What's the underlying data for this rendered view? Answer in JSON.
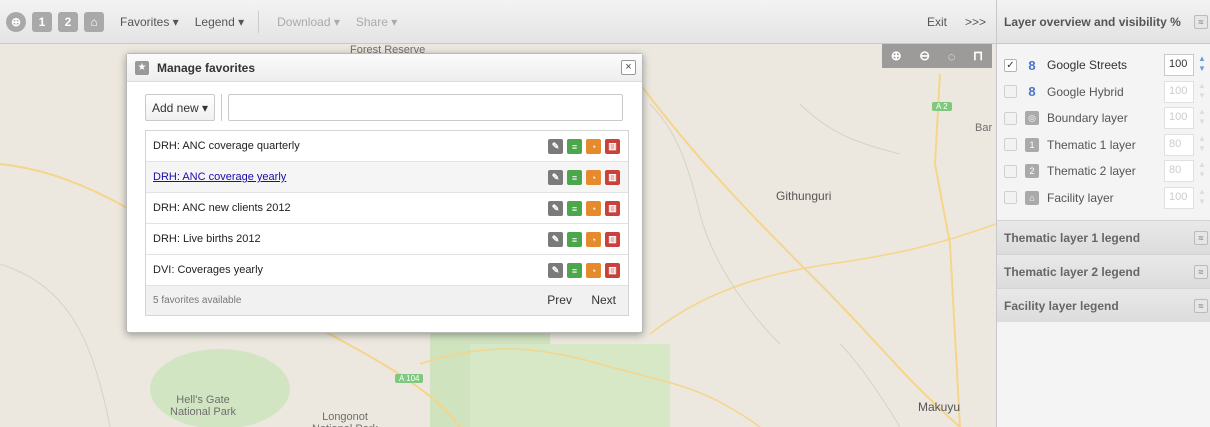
{
  "toolbar": {
    "icon_numbers": [
      "1",
      "2"
    ],
    "menus": [
      {
        "label": "Favorites ▾",
        "enabled": true
      },
      {
        "label": "Legend ▾",
        "enabled": true
      },
      {
        "label": "Download ▾",
        "enabled": false
      },
      {
        "label": "Share ▾",
        "enabled": false
      }
    ],
    "exit_label": "Exit",
    "expand_label": ">>>"
  },
  "map": {
    "controls": [
      "zoom-in",
      "zoom-out",
      "locate",
      "measure"
    ],
    "labels": {
      "forest": "Forest Reserve",
      "githunguri": "Githunguri",
      "bar": "Bar",
      "hells_gate": "Hell's Gate\nNational Park",
      "longonot": "Longonot\nNational Park",
      "makuyu": "Makuyu"
    },
    "road_badges": {
      "a2": "A 2",
      "a104": "A 104"
    }
  },
  "dialog": {
    "title": "Manage favorites",
    "close_label": "×",
    "add_new_label": "Add new ▾",
    "search_value": "",
    "favorites": [
      {
        "name": "DRH: ANC coverage quarterly",
        "hover": false
      },
      {
        "name": "DRH: ANC coverage yearly",
        "hover": true
      },
      {
        "name": "DRH: ANC new clients 2012",
        "hover": false
      },
      {
        "name": "DRH: Live births 2012",
        "hover": false
      },
      {
        "name": "DVI: Coverages yearly",
        "hover": false
      }
    ],
    "count_text": "5 favorites available",
    "prev_label": "Prev",
    "next_label": "Next"
  },
  "panel": {
    "title": "Layer overview and visibility %",
    "layers": [
      {
        "name": "Google Streets",
        "checked": true,
        "opacity": "100",
        "icon": "google-icon"
      },
      {
        "name": "Google Hybrid",
        "checked": false,
        "opacity": "100",
        "icon": "google-icon"
      },
      {
        "name": "Boundary layer",
        "checked": false,
        "opacity": "100",
        "icon": "boundary-icon"
      },
      {
        "name": "Thematic 1 layer",
        "checked": false,
        "opacity": "80",
        "icon": "thematic-1-icon",
        "icon_text": "1"
      },
      {
        "name": "Thematic 2 layer",
        "checked": false,
        "opacity": "80",
        "icon": "thematic-2-icon",
        "icon_text": "2"
      },
      {
        "name": "Facility layer",
        "checked": false,
        "opacity": "100",
        "icon": "facility-icon"
      }
    ],
    "sections": [
      "Thematic layer 1 legend",
      "Thematic layer 2 legend",
      "Facility layer legend"
    ]
  },
  "colors": {
    "link": "#1a0dab",
    "edit": "#7a7a7a",
    "list": "#4ca64c",
    "pie": "#e68a2e",
    "delete": "#c9413a"
  }
}
